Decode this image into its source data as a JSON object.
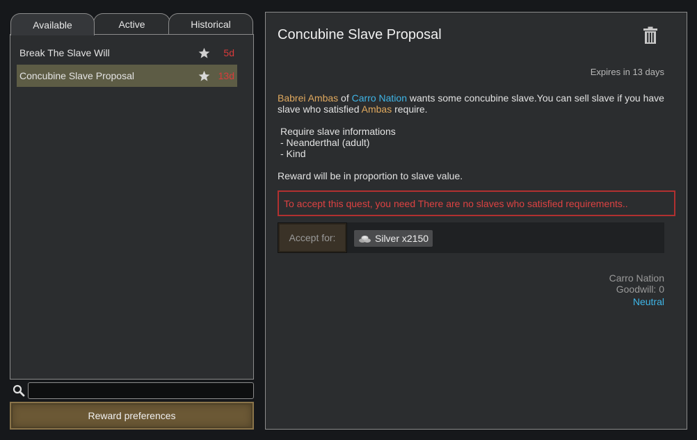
{
  "tabs": [
    {
      "label": "Available",
      "active": true
    },
    {
      "label": "Active",
      "active": false
    },
    {
      "label": "Historical",
      "active": false
    }
  ],
  "quests": [
    {
      "title": "Break The Slave Will",
      "days": "5d",
      "starred": true,
      "selected": false
    },
    {
      "title": "Concubine Slave Proposal",
      "days": "13d",
      "starred": true,
      "selected": true
    }
  ],
  "search": {
    "value": "",
    "icon": "search-icon"
  },
  "reward_preferences_label": "Reward preferences",
  "detail": {
    "title": "Concubine Slave Proposal",
    "trash_icon": "trash-icon",
    "expires": "Expires in 13 days",
    "description": {
      "asker": "Babrei Ambas",
      "of": " of ",
      "faction": "Carro Nation",
      "text1": " wants some concubine slave.You can sell slave if you have slave who satisfied ",
      "asker_short": "Ambas",
      "text2": " require."
    },
    "requirements": {
      "heading": "Require slave informations",
      "items": [
        "- Neanderthal (adult)",
        "- Kind"
      ]
    },
    "reward_note": "Reward will be in proportion to slave value.",
    "warning": "To accept this quest, you need There are no slaves who satisfied requirements..",
    "accept_label": "Accept for:",
    "reward_item": {
      "icon": "silver-icon",
      "label": "Silver x2150"
    },
    "faction_info": {
      "name": "Carro Nation",
      "goodwill": "Goodwill: 0",
      "relation": "Neutral"
    }
  },
  "colors": {
    "accent_blue": "#3fb6e8",
    "accent_orange": "#e0a95e",
    "warning_red": "#de4242",
    "selected_row": "#5d5c45",
    "button_brown": "#6b5835"
  }
}
